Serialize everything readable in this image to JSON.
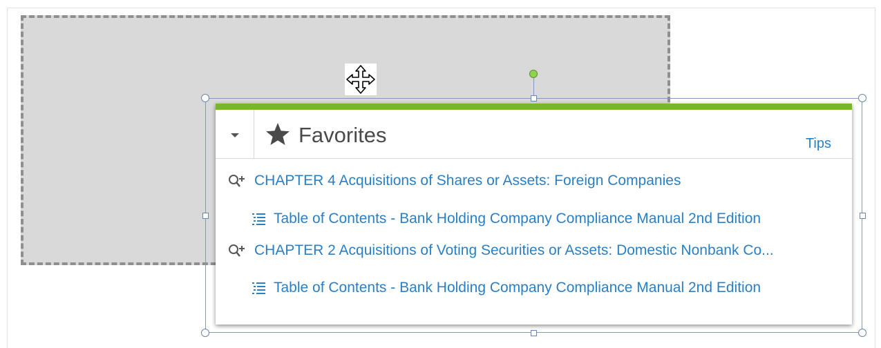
{
  "widget": {
    "title": "Favorites",
    "tips_label": "Tips",
    "accent_color": "#76b82a",
    "link_color": "#2a7fc4"
  },
  "favorites": [
    {
      "type": "chapter",
      "icon": "search-plus-icon",
      "label": "CHAPTER 4 Acquisitions of Shares or Assets: Foreign Companies"
    },
    {
      "type": "toc",
      "icon": "list-icon",
      "label": "Table of Contents - Bank Holding Company Compliance Manual 2nd Edition"
    },
    {
      "type": "chapter",
      "icon": "search-plus-icon",
      "label": "CHAPTER 2 Acquisitions of Voting Securities or Assets: Domestic Nonbank Co..."
    },
    {
      "type": "toc",
      "icon": "list-icon",
      "label": "Table of Contents - Bank Holding Company Compliance Manual 2nd Edition"
    }
  ]
}
